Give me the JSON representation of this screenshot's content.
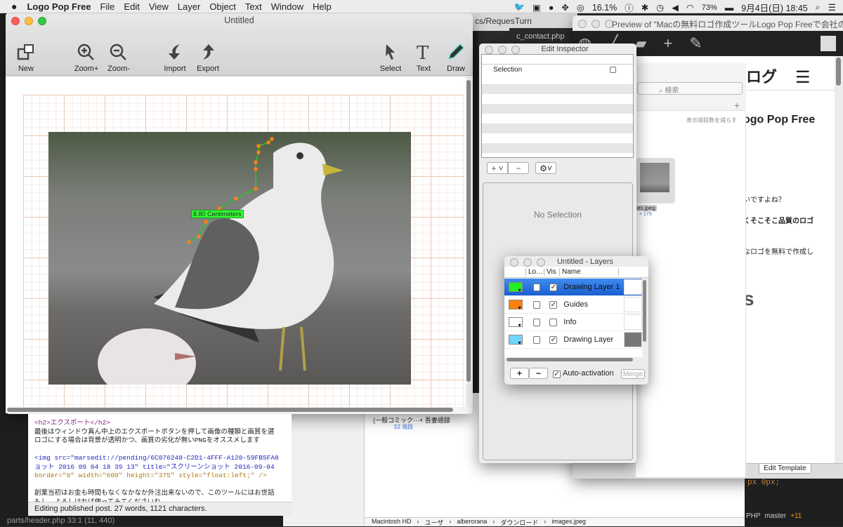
{
  "menubar": {
    "app": "Logo Pop Free",
    "items": [
      "File",
      "Edit",
      "View",
      "Layer",
      "Object",
      "Text",
      "Window",
      "Help"
    ],
    "cpu": "16.1%",
    "battery": "73%",
    "datetime": "9月4日(日) 18:45"
  },
  "main_window": {
    "title": "Untitled",
    "toolbar": {
      "new": "New",
      "zoom_in": "Zoom+",
      "zoom_out": "Zoom-",
      "import": "Import",
      "export": "Export",
      "select": "Select",
      "text": "Text",
      "draw": "Draw"
    },
    "measurement_label": "8.80 Centimeters",
    "colors": {
      "path": "#22cc22",
      "points": "#ff7f1a",
      "label_bg": "#33ff33"
    }
  },
  "background": {
    "tab_path": "cs/RequesTurn",
    "tab_file": "c_contact.php",
    "editor_lines": [
      "<h2>エクスポート</h2>",
      "最後はウィンドウ真ん中上のエクスポートボタンを押して画像の種類と画質を選",
      "ロゴにする場合は背景が透明かつ、画質の劣化が無いPNGをオススメします",
      "",
      "<img src=\"marsedit://pending/6C076248-C2D1-4FFF-A120-59FB5FA8",
      "ョット 2016 09 04 18 39 13\" title=\"スクリーンショット 2016-09-04",
      "border=\"0\" width=\"600\" height=\"375\" style=\"float:left;\" />",
      "",
      "創業当初はお金も時間もなくなかなか外注出来ないので、このツールにはお世話",
      "もし、よろしければ使ってみてくださいね。"
    ],
    "editor_status": "Editing published post. 27 words, 1121 characters.",
    "file_status": "parts/header.php   33:1   (11, 440)",
    "finder_item": "(一般コミック···+ 吾妻語録",
    "finder_count": "52 項目",
    "finder_search": "検索",
    "finder_reduce": "表示項目数を減らす",
    "finder_file": "es.jpeg",
    "finder_dims": "× 175",
    "breadcrumb": [
      "Macintosh HD",
      "ユーザ",
      "alberorana",
      "ダウンロード",
      "images.jpeg"
    ],
    "preview_title": "Preview of \"Macの無料ロゴ作成ツールLogo Pop Freeで会社のロ…",
    "preview_lines": [
      "ブログ",
      "ogo Pop Free",
      "いですよね？",
      "くそこそこ品質のロゴ",
      "なロゴを無料で作成し",
      "s"
    ],
    "edit_template": "Edit Template",
    "code_snippet": "px 0px;",
    "git": {
      "lang": "PHP",
      "branch": "master",
      "changes": "+11"
    }
  },
  "inspector": {
    "title": "Edit Inspector",
    "row": "Selection",
    "empty": "No Selection"
  },
  "layers": {
    "title": "Untitled - Layers",
    "headers": [
      "Lo…",
      "Vis",
      "Name"
    ],
    "rows": [
      {
        "name": "Drawing Layer 1",
        "color": "#22ee22",
        "locked": false,
        "visible": true,
        "selected": true
      },
      {
        "name": "Guides",
        "color": "#ff7f10",
        "locked": false,
        "visible": true
      },
      {
        "name": "Info",
        "color": "#ffffff",
        "locked": false,
        "visible": false
      },
      {
        "name": "Drawing Layer",
        "color": "#6fd6ff",
        "locked": false,
        "visible": true
      }
    ],
    "auto_activation": "Auto-activation",
    "auto_checked": true,
    "merge": "Merge",
    "add": "+",
    "remove": "−"
  }
}
